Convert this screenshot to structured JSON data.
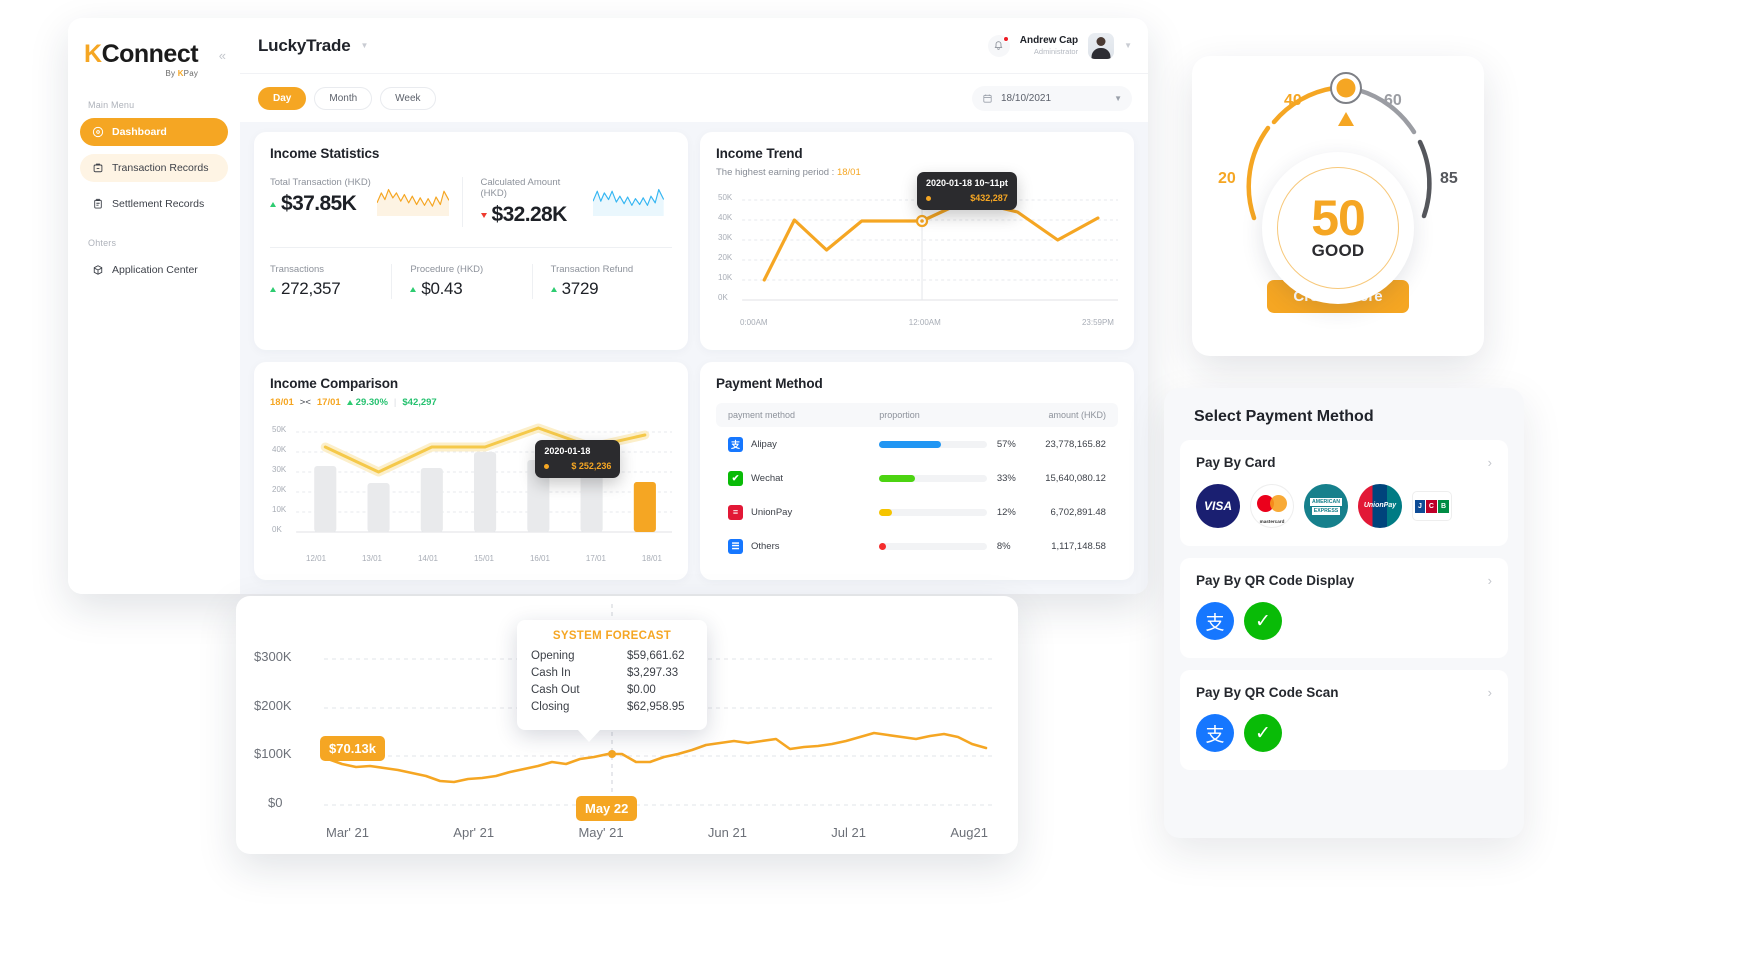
{
  "brand": {
    "logo_main": "Connect",
    "logo_k": "K",
    "logo_sub_prefix": "By ",
    "logo_sub_k": "K",
    "logo_sub_rest": "Pay"
  },
  "sidebar": {
    "main_menu_label": "Main Menu",
    "others_label": "Ohters",
    "items": [
      {
        "label": "Dashboard",
        "icon": "dashboard-icon",
        "state": "active"
      },
      {
        "label": "Transaction Records",
        "icon": "transaction-icon",
        "state": "soft"
      },
      {
        "label": "Settlement Records",
        "icon": "settlement-icon",
        "state": "plain"
      }
    ],
    "others_items": [
      {
        "label": "Application Center",
        "icon": "application-center-icon"
      }
    ]
  },
  "header": {
    "business_name": "LuckyTrade",
    "user_name": "Andrew Cap",
    "user_role": "Administrator",
    "period_tabs": [
      {
        "label": "Day",
        "active": true
      },
      {
        "label": "Month",
        "active": false
      },
      {
        "label": "Week",
        "active": false
      }
    ],
    "date_value": "18/10/2021"
  },
  "income_statistics": {
    "title": "Income Statistics",
    "top": [
      {
        "label": "Total Transaction (HKD)",
        "value": "$37.85K",
        "trend": "up",
        "spark_color": "#F5A623"
      },
      {
        "label": "Calculated Amount (HKD)",
        "value": "$32.28K",
        "trend": "down",
        "spark_color": "#35B6F2"
      }
    ],
    "bottom": [
      {
        "label": "Transactions",
        "value": "272,357",
        "trend": "up"
      },
      {
        "label": "Procedure (HKD)",
        "value": "$0.43",
        "trend": "up"
      },
      {
        "label": "Transaction Refund",
        "value": "3729",
        "trend": "up"
      }
    ]
  },
  "income_trend": {
    "title": "Income Trend",
    "note_prefix": "The highest earning period : ",
    "note_value": "18/01",
    "tooltip": {
      "title": "2020-01-18 10~11pt",
      "value": "$432,287"
    },
    "chart_data": {
      "type": "line",
      "title": "Income Trend",
      "xlabel": "",
      "ylabel": "",
      "ylim": [
        0,
        50000
      ],
      "yticks": [
        "0K",
        "10K",
        "20K",
        "30K",
        "40K",
        "50K"
      ],
      "xticks": [
        "0:00AM",
        "12:00AM",
        "23:59PM"
      ],
      "grid": true,
      "series": [
        {
          "name": "income",
          "color": "#F5A623",
          "x": [
            0,
            1,
            2,
            3,
            4,
            5,
            6,
            7,
            8,
            9
          ],
          "values": [
            14000,
            38000,
            26500,
            37500,
            37500,
            37500,
            47500,
            44000,
            30000,
            37000
          ]
        }
      ],
      "highlight_point": {
        "x": 5,
        "y": 37500,
        "label": "$432,287"
      }
    }
  },
  "income_comparison": {
    "title": "Income Comparison",
    "compare_left": "18/01",
    "compare_symbol": "><",
    "compare_right": "17/01",
    "delta_pct": "29.30%",
    "delta_amount": "$42,297",
    "tooltip": {
      "title": "2020-01-18",
      "value": "$ 252,236"
    },
    "chart_data": {
      "type": "bar",
      "title": "Income Comparison",
      "categories": [
        "12/01",
        "13/01",
        "14/01",
        "15/01",
        "16/01",
        "17/01",
        "18/01"
      ],
      "values": [
        33000,
        24500,
        32000,
        40000,
        36000,
        30500,
        25000
      ],
      "bar_colors": [
        "#E9EAEC",
        "#E9EAEC",
        "#E9EAEC",
        "#E9EAEC",
        "#E9EAEC",
        "#E9EAEC",
        "#F5A623"
      ],
      "ylim": [
        0,
        50000
      ],
      "yticks": [
        "0K",
        "10K",
        "20K",
        "30K",
        "40K",
        "50K"
      ],
      "grid": true,
      "series": [
        {
          "name": "trend-line",
          "color": "#F5C94A",
          "values": [
            42500,
            30000,
            45000,
            45000,
            52000,
            45000,
            49000
          ]
        }
      ]
    }
  },
  "payment_method": {
    "title": "Payment Method",
    "columns": [
      "payment method",
      "proportion",
      "amount (HKD)"
    ],
    "rows": [
      {
        "method": "Alipay",
        "icon": "alipay-icon",
        "icon_bg": "#1677FF",
        "pct": "57%",
        "pct_value": 57,
        "bar_color": "#2196F3",
        "amount": "23,778,165.82"
      },
      {
        "method": "Wechat",
        "icon": "wechat-icon",
        "icon_bg": "#09BB07",
        "pct": "33%",
        "pct_value": 33,
        "bar_color": "#4CD411",
        "amount": "15,640,080.12"
      },
      {
        "method": "UnionPay",
        "icon": "unionpay-icon",
        "icon_bg": "#E21836",
        "pct": "12%",
        "pct_value": 12,
        "bar_color": "#F5C400",
        "amount": "6,702,891.48"
      },
      {
        "method": "Others",
        "icon": "others-icon",
        "icon_bg": "#1677FF",
        "pct": "8%",
        "pct_value": 6,
        "bar_color": "#F42C2C",
        "amount": "1,117,148.58"
      }
    ],
    "chart_data": {
      "type": "bar",
      "title": "Payment Method proportion",
      "categories": [
        "Alipay",
        "Wechat",
        "UnionPay",
        "Others"
      ],
      "values": [
        57,
        33,
        12,
        8
      ],
      "ylabel": "proportion (%)",
      "ylim": [
        0,
        100
      ]
    }
  },
  "credit_score": {
    "score": "50",
    "rating": "GOOD",
    "button_label": "Credit Score",
    "ticks": [
      "20",
      "40",
      "60",
      "85"
    ],
    "chart_data": {
      "type": "gauge",
      "title": "Credit Score",
      "value": 50,
      "rating": "GOOD",
      "scale_labels": [
        20,
        40,
        60,
        85
      ],
      "range": [
        0,
        100
      ],
      "arc_color": "#F5A623",
      "track_color": "#9B9DA3"
    }
  },
  "select_payment": {
    "title": "Select Payment Method",
    "sections": [
      {
        "label": "Pay By Card",
        "logos": [
          {
            "name": "visa-logo",
            "text": "VISA"
          },
          {
            "name": "mastercard-logo",
            "text": "mastercard"
          },
          {
            "name": "amex-logo",
            "text": "AMERICAN EXPRESS"
          },
          {
            "name": "unionpay-logo",
            "text": "UnionPay"
          },
          {
            "name": "jcb-logo",
            "text": "JCB"
          }
        ]
      },
      {
        "label": "Pay By QR Code Display",
        "logos": [
          {
            "name": "alipay-logo",
            "text": "支"
          },
          {
            "name": "wechat-logo",
            "text": "✓"
          }
        ]
      },
      {
        "label": "Pay By QR Code Scan",
        "logos": [
          {
            "name": "alipay-logo",
            "text": "支"
          },
          {
            "name": "wechat-logo",
            "text": "✓"
          }
        ]
      }
    ]
  },
  "forecast": {
    "tooltip_title": "SYSTEM FORECAST",
    "tooltip_rows": [
      {
        "key": "Opening",
        "value": "$59,661.62"
      },
      {
        "key": "Cash In",
        "value": "$3,297.33"
      },
      {
        "key": "Cash Out",
        "value": "$0.00"
      },
      {
        "key": "Closing",
        "value": "$62,958.95"
      }
    ],
    "value_badge": "$70.13k",
    "date_badge": "May 22",
    "chart_data": {
      "type": "line",
      "title": "System Forecast Balance",
      "xlabel": "",
      "ylabel": "",
      "yticks": [
        "$0",
        "$100K",
        "$200K",
        "$300K"
      ],
      "ylim": [
        0,
        300000
      ],
      "xticks": [
        "Mar' 21",
        "Apr' 21",
        "May' 21",
        "Jun 21",
        "Jul 21",
        "Aug21"
      ],
      "grid": true,
      "annotations": [
        {
          "label": "$70.13k",
          "type": "value-badge"
        },
        {
          "label": "May 22",
          "type": "date-badge"
        }
      ],
      "series": [
        {
          "name": "balance",
          "color": "#F5A623",
          "values": [
            112000,
            104000,
            98000,
            100000,
            97000,
            93000,
            88000,
            82000,
            72000,
            70000,
            74000,
            76000,
            80000,
            86000,
            92000,
            98000,
            104000,
            102000,
            110000,
            112000,
            118000,
            118000,
            104000,
            104000,
            112000,
            118000,
            124000,
            132000,
            136000,
            140000,
            136000,
            140000,
            142000,
            126000
          ]
        }
      ]
    }
  }
}
